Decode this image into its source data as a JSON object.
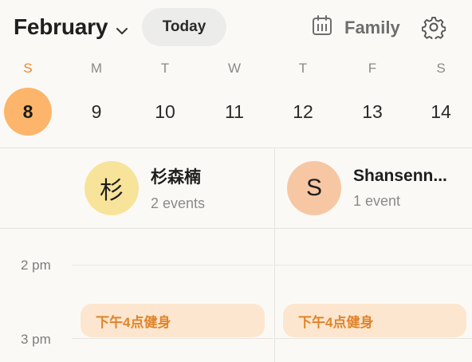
{
  "header": {
    "month": "February",
    "today_label": "Today",
    "calendar_label": "Family",
    "icons": [
      "chevron-down-icon",
      "calendar-grid-icon",
      "gear-icon"
    ]
  },
  "week": {
    "days": [
      {
        "dow": "S",
        "num": "8",
        "selected": true
      },
      {
        "dow": "M",
        "num": "9"
      },
      {
        "dow": "T",
        "num": "10"
      },
      {
        "dow": "W",
        "num": "11"
      },
      {
        "dow": "T",
        "num": "12"
      },
      {
        "dow": "F",
        "num": "13"
      },
      {
        "dow": "S",
        "num": "14"
      }
    ]
  },
  "people": [
    {
      "initial": "杉",
      "name": "杉森楠",
      "events": "2 events",
      "color": "#f7e49a"
    },
    {
      "initial": "S",
      "name": "Shansenn...",
      "events": "1 event",
      "color": "#f7c7a3"
    }
  ],
  "timeline": {
    "times": [
      "2 pm",
      "3 pm"
    ],
    "events": [
      {
        "title": "下午4点健身"
      },
      {
        "title": "下午4点健身"
      }
    ]
  },
  "colors": {
    "accent": "#fcb56b",
    "accent_text": "#e68a2e",
    "event_bg": "#fde6cf",
    "event_text": "#e0842a"
  }
}
